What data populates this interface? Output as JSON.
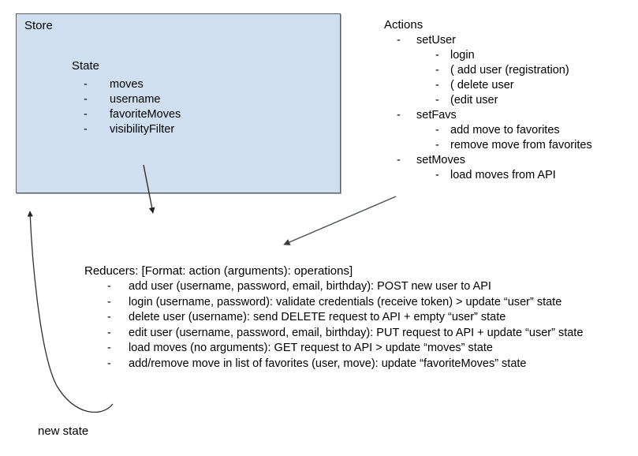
{
  "store": {
    "title": "Store",
    "state_heading": "State",
    "state_items": [
      "moves",
      "username",
      "favoriteMoves",
      "visibilityFilter"
    ]
  },
  "actions": {
    "heading": "Actions",
    "groups": [
      {
        "name": "setUser",
        "items": [
          "login",
          "( add user (registration)",
          "( delete user",
          "(edit user"
        ]
      },
      {
        "name": "setFavs",
        "items": [
          "add move to favorites",
          "remove move from favorites"
        ]
      },
      {
        "name": "setMoves",
        "items": [
          "load moves from API"
        ]
      }
    ]
  },
  "reducers": {
    "heading": "Reducers: [Format: action (arguments): operations]",
    "items": [
      "add user (username, password, email, birthday): POST new user to API",
      "login (username, password): validate credentials (receive token) > update “user” state",
      "delete user (username): send DELETE request to API + empty “user” state",
      "edit user (username, password, email, birthday): PUT request to API + update “user” state",
      "load moves (no arguments): GET request to API > update “moves” state",
      "add/remove move in list of favorites (user, move): update “favoriteMoves” state"
    ]
  },
  "labels": {
    "new_state": "new state",
    "bullet_dash": "-"
  },
  "colors": {
    "store_fill": "#cfdff0",
    "store_border": "#5a5f66",
    "arrow": "#3b3b3b",
    "text": "#000000",
    "background": "#ffffff"
  },
  "arrows": [
    {
      "name": "store-to-reducers",
      "from": "Store box interior",
      "to": "Reducers area"
    },
    {
      "name": "actions-to-reducers",
      "from": "Actions list",
      "to": "Reducers area"
    },
    {
      "name": "new-state-to-store",
      "from": "new state label",
      "to": "Store box"
    }
  ]
}
